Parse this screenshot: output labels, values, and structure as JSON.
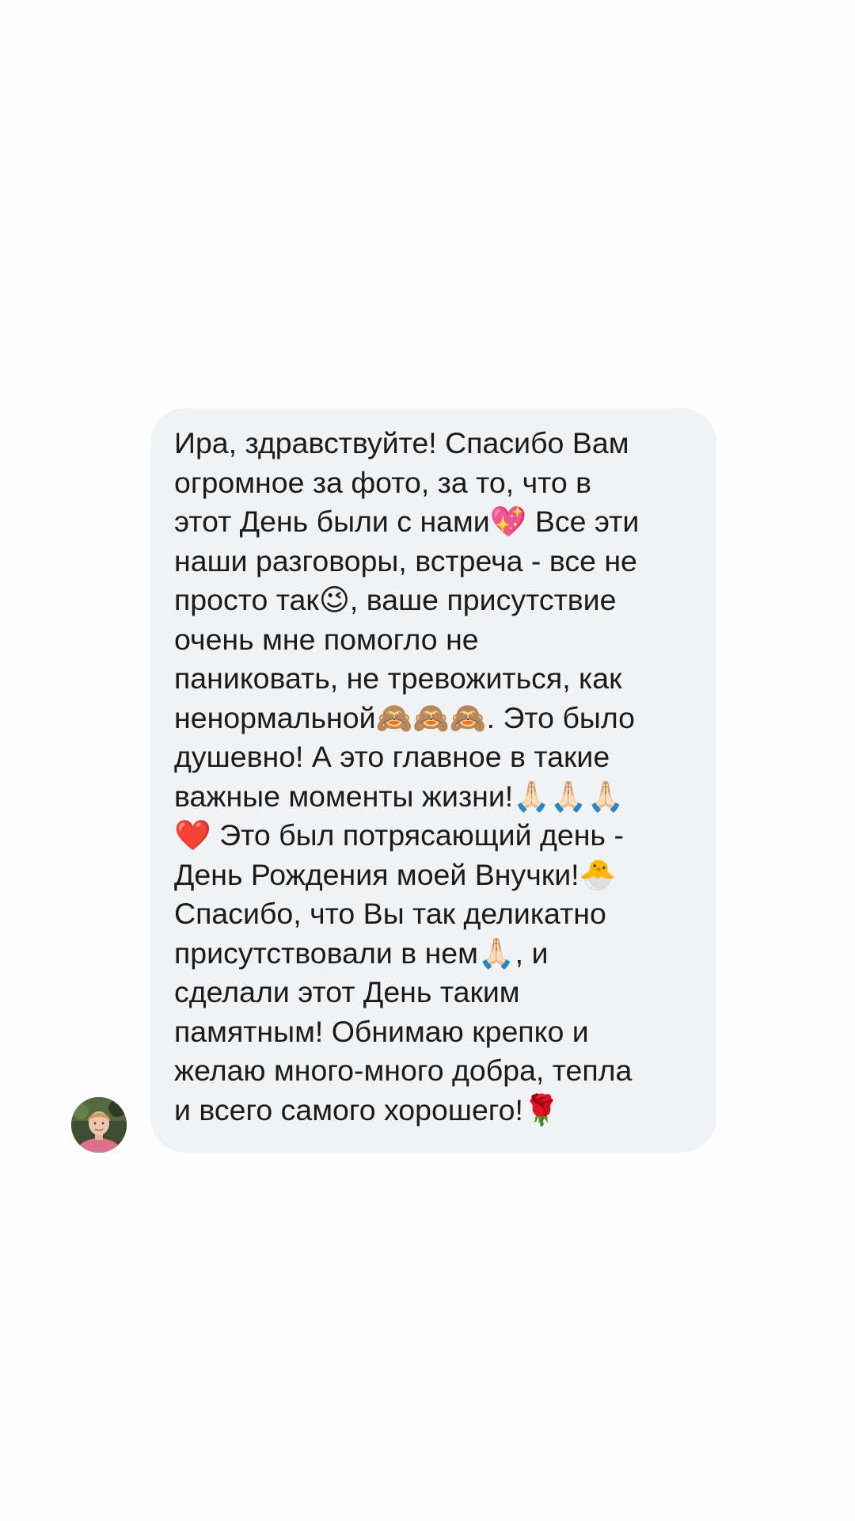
{
  "conversation": {
    "received_message": {
      "lines": [
        "Ира, здравствуйте! Спасибо Вам",
        "огромное за фото, за то, что в",
        "этот День были с нами💖 Все эти",
        "наши разговоры, встреча - все не",
        "просто так😉, ваше присутствие",
        "очень мне помогло не",
        "паниковать, не тревожиться, как",
        "ненормальной🙈🙈🙈. Это было",
        "душевно! А это главное в такие",
        "важные моменты жизни!🙏🏻🙏🏻🙏🏻",
        "❤️ Это был потрясающий день -",
        "День Рождения моей Внучки!🐣",
        "Спасибо, что Вы так деликатно",
        "присутствовали в нем🙏🏻, и",
        "сделали этот День таким",
        "памятным! Обнимаю крепко и",
        "желаю много-много добра, тепла",
        "и всего самого хорошего!🌹"
      ]
    },
    "sender_avatar": {
      "icon": "user-avatar-photo"
    }
  },
  "colors": {
    "background": "#fefefe",
    "bubble": "#f1f2f4",
    "text": "#1b1b1b"
  }
}
